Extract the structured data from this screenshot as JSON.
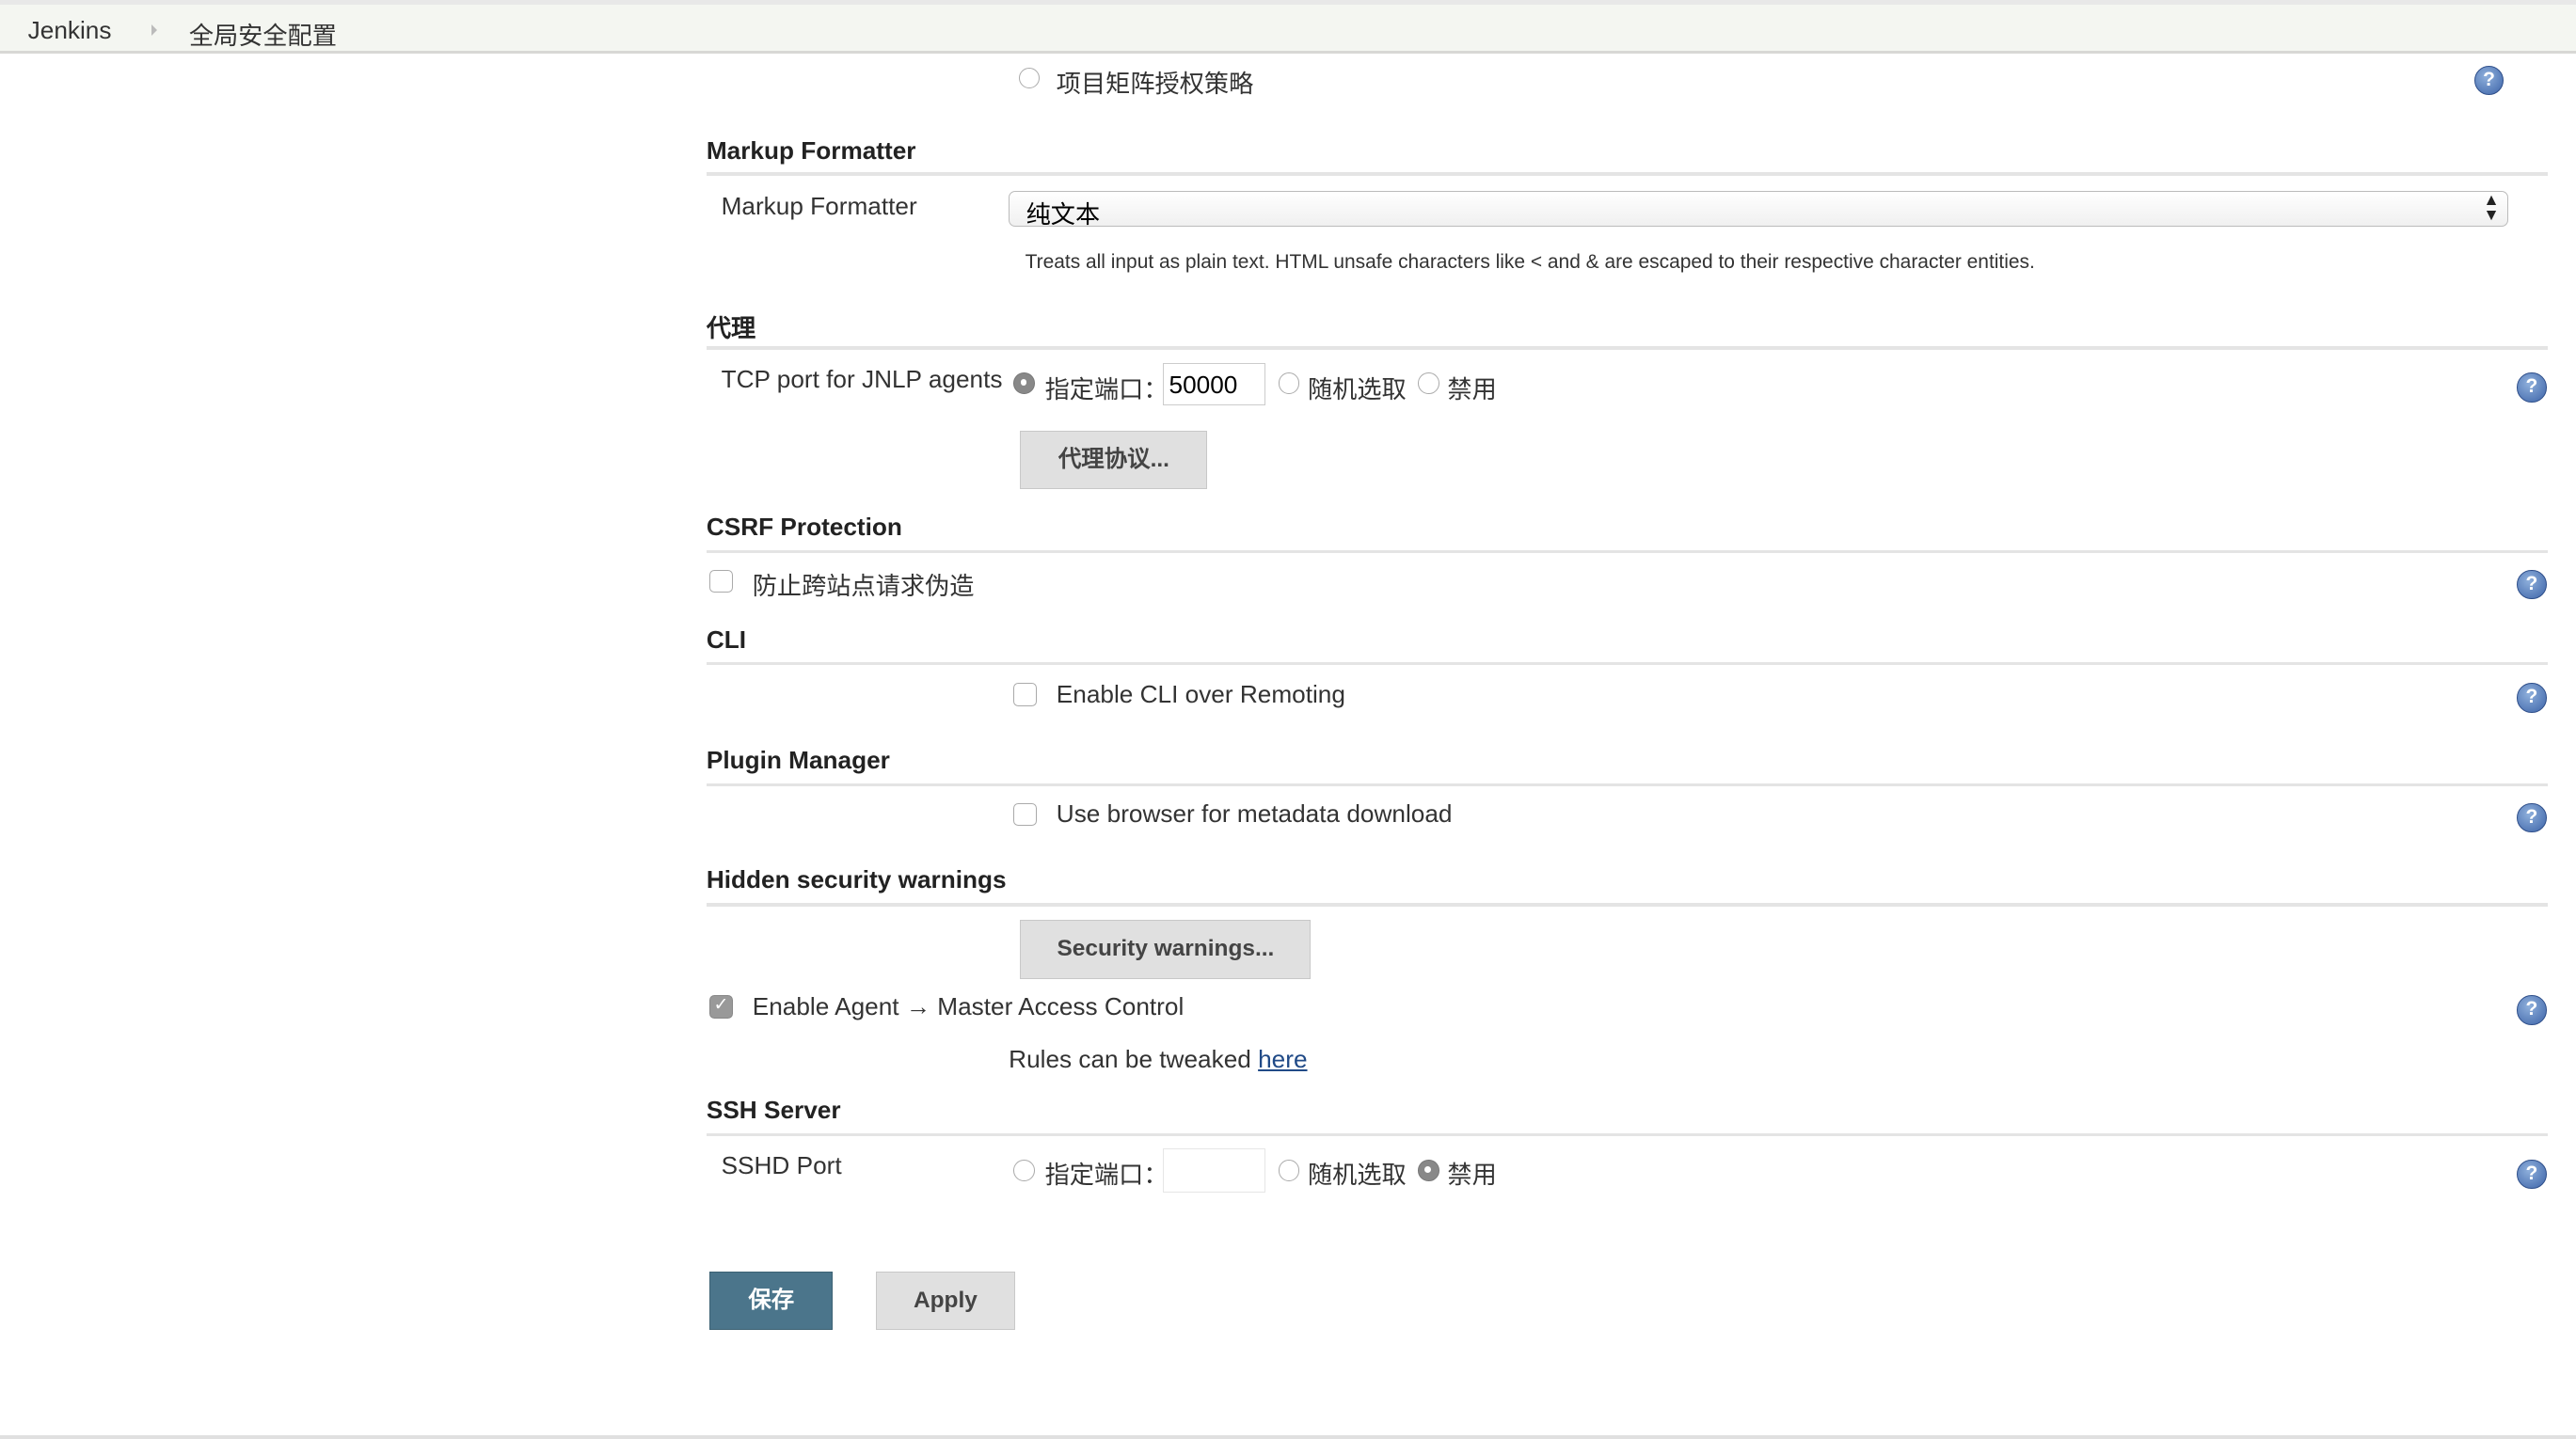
{
  "breadcrumb": {
    "root": "Jenkins",
    "current": "全局安全配置"
  },
  "authorization": {
    "option_label": "项目矩阵授权策略"
  },
  "markup_formatter": {
    "section": "Markup Formatter",
    "label": "Markup Formatter",
    "selected": "纯文本",
    "description": "Treats all input as plain text. HTML unsafe characters like < and & are escaped to their respective character entities."
  },
  "agents": {
    "section": "代理",
    "label": "TCP port for JNLP agents",
    "fixed_label": "指定端口：",
    "port_value": "50000",
    "random_label": "随机选取",
    "disable_label": "禁用",
    "selected": "fixed",
    "protocols_button": "代理协议..."
  },
  "csrf": {
    "section": "CSRF Protection",
    "checkbox_label": "防止跨站点请求伪造",
    "checked": false
  },
  "cli": {
    "section": "CLI",
    "checkbox_label": "Enable CLI over Remoting",
    "checked": false
  },
  "plugin_manager": {
    "section": "Plugin Manager",
    "checkbox_label": "Use browser for metadata download",
    "checked": false
  },
  "hidden_warnings": {
    "section": "Hidden security warnings",
    "button": "Security warnings...",
    "agent_access_label": "Enable Agent → Master Access Control",
    "agent_access_checked": true,
    "rules_text": "Rules can be tweaked ",
    "rules_link": "here"
  },
  "ssh": {
    "section": "SSH Server",
    "label": "SSHD Port",
    "fixed_label": "指定端口：",
    "port_value": "",
    "random_label": "随机选取",
    "disable_label": "禁用",
    "selected": "disable"
  },
  "actions": {
    "save": "保存",
    "apply": "Apply"
  },
  "colors": {
    "save_button": "#4b758b",
    "link": "#204a87",
    "help_icon": "#3d64a8"
  }
}
